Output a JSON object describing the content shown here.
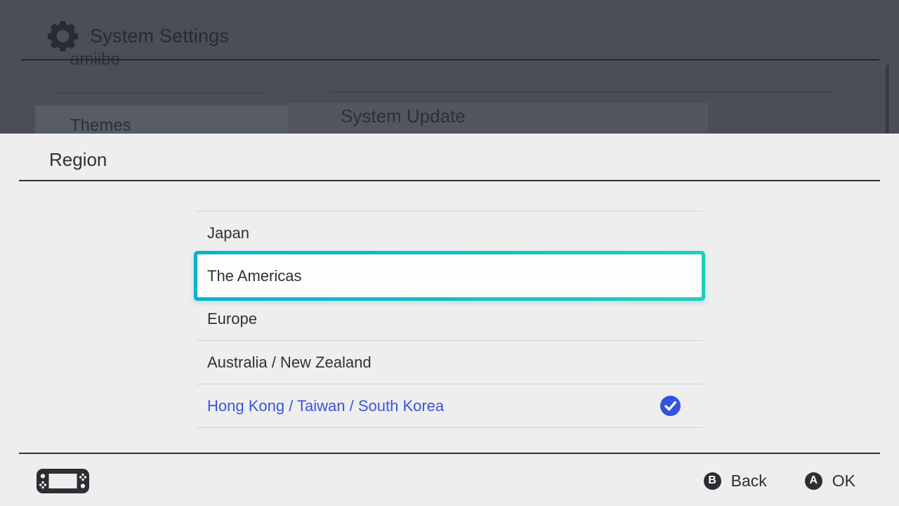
{
  "background_screen": {
    "header_title": "System Settings",
    "sidebar": {
      "scrolled_item": "amiibo",
      "selected_item": "Themes"
    },
    "main_panel": {
      "first_item": "System Update"
    }
  },
  "region_dialog": {
    "title": "Region",
    "options": [
      {
        "label": "Japan",
        "state": "default"
      },
      {
        "label": "The Americas",
        "state": "focused"
      },
      {
        "label": "Europe",
        "state": "default"
      },
      {
        "label": "Australia / New Zealand",
        "state": "default"
      },
      {
        "label": "Hong Kong / Taiwan / South Korea",
        "state": "selected",
        "checked": true
      }
    ]
  },
  "footer": {
    "buttons": [
      {
        "key": "B",
        "label": "Back"
      },
      {
        "key": "A",
        "label": "OK"
      }
    ]
  },
  "icons": {
    "header": "gear-icon",
    "footer_left": "switch-handheld-console-icon",
    "selected_mark": "check-icon"
  },
  "colors": {
    "dim_background": "#494e57",
    "dialog_background": "#eeeeee",
    "focus_teal_start": "#0cb2cd",
    "focus_teal_end": "#1fceb9",
    "selected_text_blue": "#4053dd",
    "check_circle_blue": "#3452e1",
    "text_dark": "#2e3136",
    "footer_text": "#2b2e33"
  }
}
